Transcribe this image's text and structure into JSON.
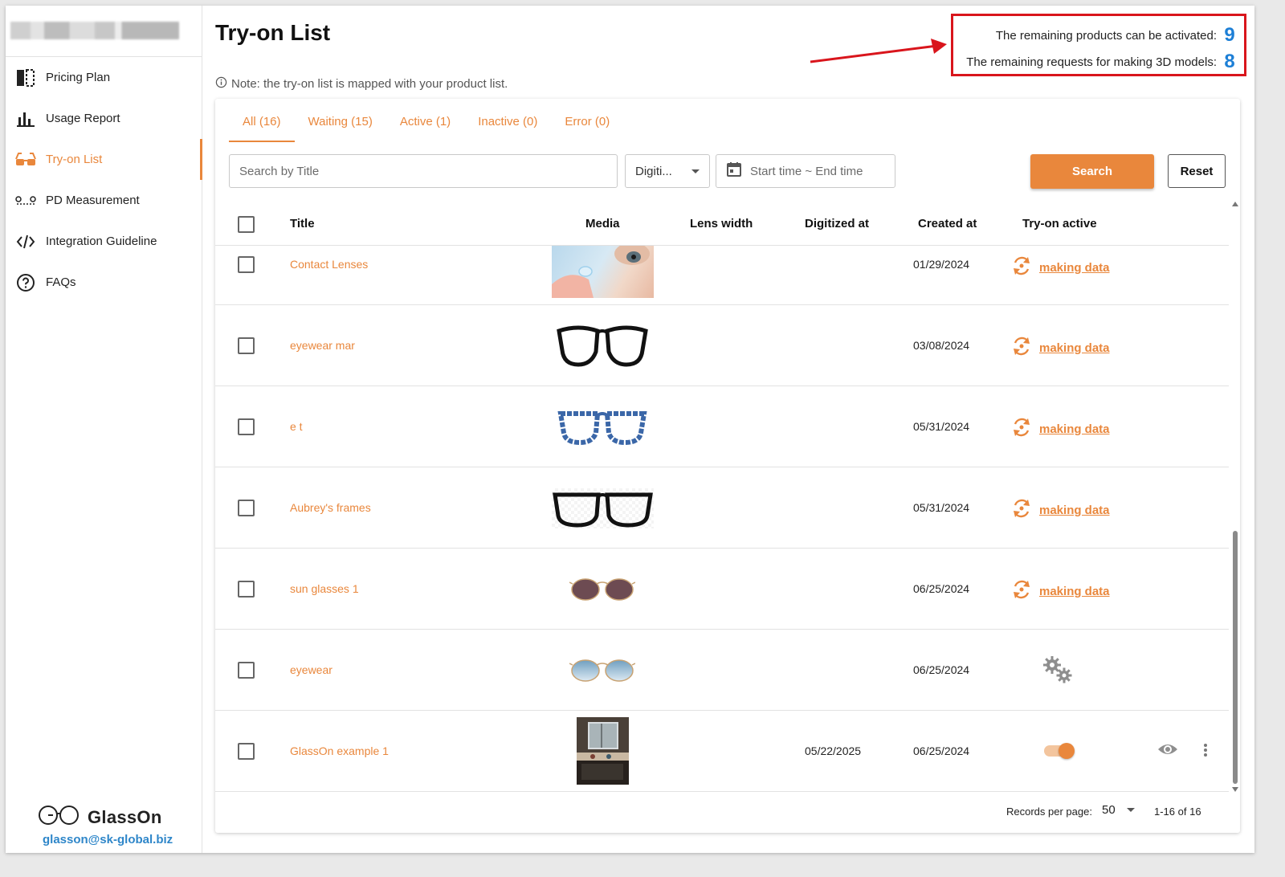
{
  "sidebar": {
    "items": [
      {
        "label": "Pricing Plan",
        "icon": "pricing-plan-icon"
      },
      {
        "label": "Usage Report",
        "icon": "bar-chart-icon"
      },
      {
        "label": "Try-on List",
        "icon": "glasses-icon"
      },
      {
        "label": "PD Measurement",
        "icon": "pd-measure-icon"
      },
      {
        "label": "Integration Guideline",
        "icon": "code-icon"
      },
      {
        "label": "FAQs",
        "icon": "help-circle-icon"
      }
    ],
    "active_index": 2,
    "brand_name": "GlassOn",
    "brand_email": "glasson@sk-global.biz"
  },
  "page": {
    "title": "Try-on List",
    "note": "Note: the try-on list is mapped with your product list."
  },
  "quota": {
    "products_label": "The remaining products can be activated:",
    "products_value": "9",
    "requests_label": "The remaining requests for making 3D models:",
    "requests_value": "8"
  },
  "tabs": [
    {
      "label": "All (16)",
      "active": true
    },
    {
      "label": "Waiting (15)"
    },
    {
      "label": "Active (1)"
    },
    {
      "label": "Inactive (0)"
    },
    {
      "label": "Error (0)"
    }
  ],
  "filters": {
    "search_placeholder": "Search by Title",
    "digitized_select": "Digiti...",
    "date_placeholder": "Start time ~ End time",
    "search_button": "Search",
    "reset_button": "Reset"
  },
  "table": {
    "columns": [
      "Title",
      "Media",
      "Lens width",
      "Digitized at",
      "Created at",
      "Try-on active"
    ],
    "rows": [
      {
        "title": "Contact Lenses",
        "media": "contact-lens-photo",
        "digitized_at": "",
        "created_at": "01/29/2024",
        "status": "making data"
      },
      {
        "title": "eyewear mar",
        "media": "black-cat-eye-frame",
        "digitized_at": "",
        "created_at": "03/08/2024",
        "status": "making data"
      },
      {
        "title": "e t",
        "media": "blue-tortoise-frame",
        "digitized_at": "",
        "created_at": "05/31/2024",
        "status": "making data"
      },
      {
        "title": "Aubrey's frames",
        "media": "black-square-frame",
        "digitized_at": "",
        "created_at": "05/31/2024",
        "status": "making data"
      },
      {
        "title": "sun glasses 1",
        "media": "brown-round-sunglasses",
        "digitized_at": "",
        "created_at": "06/25/2024",
        "status": "making data"
      },
      {
        "title": "eyewear",
        "media": "blue-gradient-sunglasses",
        "digitized_at": "",
        "created_at": "06/25/2024",
        "status": "processing"
      },
      {
        "title": "GlassOn example 1",
        "media": "room-photo",
        "digitized_at": "05/22/2025",
        "created_at": "06/25/2024",
        "status": "active"
      }
    ]
  },
  "pagination": {
    "records_label": "Records per page:",
    "per_page": "50",
    "range": "1-16 of 16"
  },
  "colors": {
    "accent": "#e9873c",
    "highlight_box": "#d9151c",
    "quota_number": "#1d7fd6",
    "email": "#2e86c9"
  }
}
